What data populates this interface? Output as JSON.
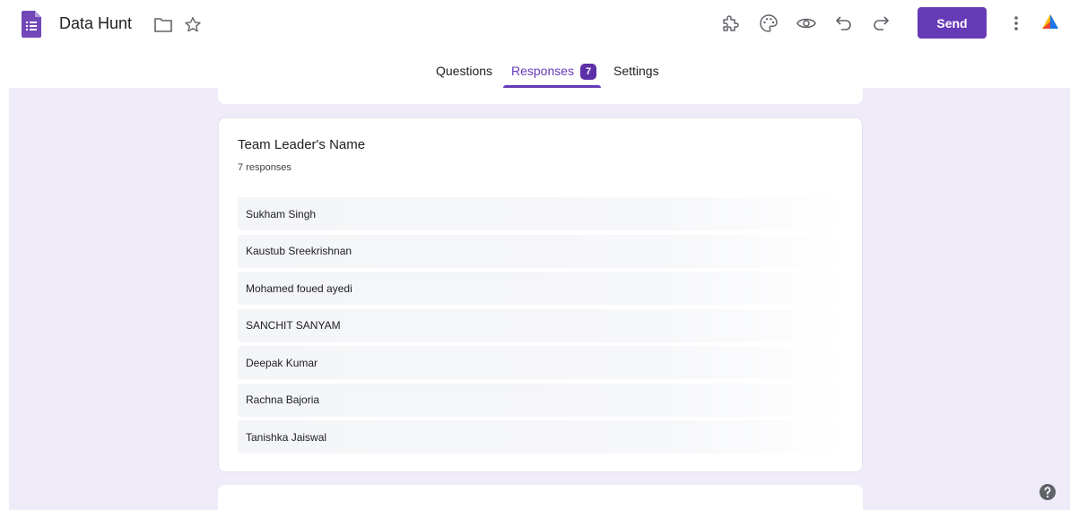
{
  "header": {
    "doc_title": "Data Hunt",
    "send_label": "Send",
    "icons": [
      "forms-logo-icon",
      "folder-icon",
      "star-icon",
      "addon-puzzle-icon",
      "palette-icon",
      "preview-eye-icon",
      "undo-icon",
      "redo-icon",
      "more-vert-icon",
      "account-icon"
    ],
    "accent_color": "#673ab7"
  },
  "tabs": {
    "questions": "Questions",
    "responses": "Responses",
    "responses_badge": "7",
    "settings": "Settings",
    "active": "Responses"
  },
  "question": {
    "title": "Team Leader's Name",
    "count": "7 responses",
    "responses": [
      "Sukham Singh",
      "Kaustub Sreekrishnan",
      "Mohamed foued ayedi",
      "SANCHIT SANYAM",
      "Deepak Kumar",
      "Rachna Bajoria",
      "Tanishka Jaiswal"
    ]
  },
  "background_color": "#f0ebf8"
}
